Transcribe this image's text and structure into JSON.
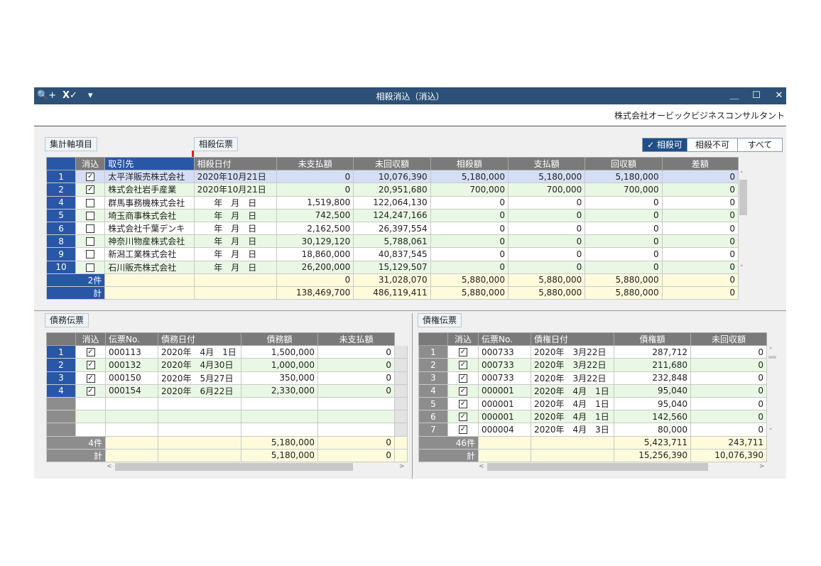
{
  "window": {
    "title": "相殺消込（消込）",
    "company": "株式会社オービックビジネスコンサルタント",
    "icons": [
      "search-plus-icon",
      "excel-icon",
      "dropdown-menu-icon"
    ],
    "controls": {
      "minimize": "＿",
      "maximize": "☐",
      "close": "✕"
    }
  },
  "labels": {
    "summary_axis": "集計軸項目",
    "offset_slip": "相殺伝票",
    "debt_slip": "債務伝票",
    "credit_slip": "債権伝票"
  },
  "filters": {
    "offsettable": "✓ 相殺可",
    "not_offsettable": "相殺不可",
    "all": "すべて"
  },
  "main": {
    "headers": [
      "消込",
      "取引先",
      "相殺日付",
      "未支払額",
      "未回収額",
      "相殺額",
      "支払額",
      "回収額",
      "差額"
    ],
    "rows": [
      {
        "no": "1",
        "check": "✓",
        "partner": "太平洋販売株式会社",
        "date": "2020年10月21日",
        "unpaid": "0",
        "uncollected": "10,076,390",
        "offset": "5,180,000",
        "payment": "5,180,000",
        "collection": "5,180,000",
        "diff": "0"
      },
      {
        "no": "2",
        "check": "✓",
        "partner": "株式会社岩手産業",
        "date": "2020年10月21日",
        "unpaid": "0",
        "uncollected": "20,951,680",
        "offset": "700,000",
        "payment": "700,000",
        "collection": "700,000",
        "diff": "0"
      },
      {
        "no": "4",
        "check": "",
        "partner": "群馬事務機株式会社",
        "date": "年　月　日",
        "unpaid": "1,519,800",
        "uncollected": "122,064,130",
        "offset": "0",
        "payment": "0",
        "collection": "0",
        "diff": "0"
      },
      {
        "no": "5",
        "check": "",
        "partner": "埼玉商事株式会社",
        "date": "年　月　日",
        "unpaid": "742,500",
        "uncollected": "124,247,166",
        "offset": "0",
        "payment": "0",
        "collection": "0",
        "diff": "0"
      },
      {
        "no": "6",
        "check": "",
        "partner": "株式会社千葉デンキ",
        "date": "年　月　日",
        "unpaid": "2,162,500",
        "uncollected": "26,397,554",
        "offset": "0",
        "payment": "0",
        "collection": "0",
        "diff": "0"
      },
      {
        "no": "8",
        "check": "",
        "partner": "神奈川物産株式会社",
        "date": "年　月　日",
        "unpaid": "30,129,120",
        "uncollected": "5,788,061",
        "offset": "0",
        "payment": "0",
        "collection": "0",
        "diff": "0"
      },
      {
        "no": "9",
        "check": "",
        "partner": "新潟工業株式会社",
        "date": "年　月　日",
        "unpaid": "18,860,000",
        "uncollected": "40,837,545",
        "offset": "0",
        "payment": "0",
        "collection": "0",
        "diff": "0"
      },
      {
        "no": "10",
        "check": "",
        "partner": "石川販売株式会社",
        "date": "年　月　日",
        "unpaid": "26,200,000",
        "uncollected": "15,129,507",
        "offset": "0",
        "payment": "0",
        "collection": "0",
        "diff": "0"
      }
    ],
    "subtotal": {
      "label": "2件",
      "unpaid": "0",
      "uncollected": "31,028,070",
      "offset": "5,880,000",
      "payment": "5,880,000",
      "collection": "5,880,000",
      "diff": "0"
    },
    "total": {
      "label": "計",
      "unpaid": "138,469,700",
      "uncollected": "486,119,411",
      "offset": "5,880,000",
      "payment": "5,880,000",
      "collection": "5,880,000",
      "diff": "0"
    }
  },
  "debt": {
    "headers": [
      "消込",
      "伝票No.",
      "債務日付",
      "債務額",
      "未支払額"
    ],
    "rows": [
      {
        "no": "1",
        "check": "✓",
        "slip": "000113",
        "date": "2020年　4月　1日",
        "amount": "1,500,000",
        "unpaid": "0"
      },
      {
        "no": "2",
        "check": "✓",
        "slip": "000132",
        "date": "2020年　4月30日",
        "amount": "1,000,000",
        "unpaid": "0"
      },
      {
        "no": "3",
        "check": "✓",
        "slip": "000150",
        "date": "2020年　5月27日",
        "amount": "350,000",
        "unpaid": "0"
      },
      {
        "no": "4",
        "check": "✓",
        "slip": "000154",
        "date": "2020年　6月22日",
        "amount": "2,330,000",
        "unpaid": "0"
      }
    ],
    "subtotal": {
      "label": "4件",
      "amount": "5,180,000",
      "unpaid": "0"
    },
    "total": {
      "label": "計",
      "amount": "5,180,000",
      "unpaid": "0"
    }
  },
  "credit": {
    "headers": [
      "消込",
      "伝票No.",
      "債権日付",
      "債権額",
      "未回収額"
    ],
    "rows": [
      {
        "no": "1",
        "check": "✓",
        "slip": "000733",
        "date": "2020年　3月22日",
        "amount": "287,712",
        "uncollected": "0"
      },
      {
        "no": "2",
        "check": "✓",
        "slip": "000733",
        "date": "2020年　3月22日",
        "amount": "211,680",
        "uncollected": "0"
      },
      {
        "no": "3",
        "check": "✓",
        "slip": "000733",
        "date": "2020年　3月22日",
        "amount": "232,848",
        "uncollected": "0"
      },
      {
        "no": "4",
        "check": "✓",
        "slip": "000001",
        "date": "2020年　4月　1日",
        "amount": "95,040",
        "uncollected": "0"
      },
      {
        "no": "5",
        "check": "✓",
        "slip": "000001",
        "date": "2020年　4月　1日",
        "amount": "95,040",
        "uncollected": "0"
      },
      {
        "no": "6",
        "check": "✓",
        "slip": "000001",
        "date": "2020年　4月　1日",
        "amount": "142,560",
        "uncollected": "0"
      },
      {
        "no": "7",
        "check": "✓",
        "slip": "000004",
        "date": "2020年　4月　3日",
        "amount": "80,000",
        "uncollected": "0"
      }
    ],
    "subtotal": {
      "label": "46件",
      "amount": "5,423,711",
      "uncollected": "243,711"
    },
    "total": {
      "label": "計",
      "amount": "15,256,390",
      "uncollected": "10,076,390"
    }
  }
}
